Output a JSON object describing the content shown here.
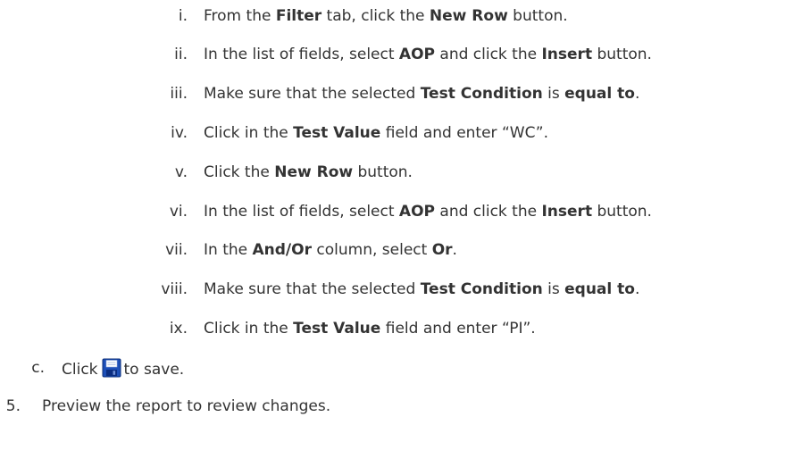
{
  "substeps": [
    {
      "numeral": "i.",
      "segments": [
        {
          "text": "From the ",
          "bold": false
        },
        {
          "text": "Filter",
          "bold": true
        },
        {
          "text": " tab, click the ",
          "bold": false
        },
        {
          "text": "New Row",
          "bold": true
        },
        {
          "text": " button.",
          "bold": false
        }
      ]
    },
    {
      "numeral": "ii.",
      "segments": [
        {
          "text": "In the list of fields, select ",
          "bold": false
        },
        {
          "text": "AOP",
          "bold": true
        },
        {
          "text": " and click the ",
          "bold": false
        },
        {
          "text": "Insert",
          "bold": true
        },
        {
          "text": " button.",
          "bold": false
        }
      ]
    },
    {
      "numeral": "iii.",
      "segments": [
        {
          "text": "Make sure that the selected ",
          "bold": false
        },
        {
          "text": "Test Condition",
          "bold": true
        },
        {
          "text": " is ",
          "bold": false
        },
        {
          "text": "equal to",
          "bold": true
        },
        {
          "text": ".",
          "bold": false
        }
      ]
    },
    {
      "numeral": "iv.",
      "segments": [
        {
          "text": "Click in the ",
          "bold": false
        },
        {
          "text": "Test Value",
          "bold": true
        },
        {
          "text": " field and enter “WC”.",
          "bold": false
        }
      ]
    },
    {
      "numeral": "v.",
      "segments": [
        {
          "text": "Click the ",
          "bold": false
        },
        {
          "text": "New Row",
          "bold": true
        },
        {
          "text": " button.",
          "bold": false
        }
      ]
    },
    {
      "numeral": "vi.",
      "segments": [
        {
          "text": "In the list of fields, select ",
          "bold": false
        },
        {
          "text": "AOP",
          "bold": true
        },
        {
          "text": " and click the ",
          "bold": false
        },
        {
          "text": "Insert",
          "bold": true
        },
        {
          "text": " button.",
          "bold": false
        }
      ]
    },
    {
      "numeral": "vii.",
      "segments": [
        {
          "text": "In the ",
          "bold": false
        },
        {
          "text": "And/Or",
          "bold": true
        },
        {
          "text": " column, select ",
          "bold": false
        },
        {
          "text": "Or",
          "bold": true
        },
        {
          "text": ".",
          "bold": false
        }
      ]
    },
    {
      "numeral": "viii.",
      "segments": [
        {
          "text": "Make sure that the selected ",
          "bold": false
        },
        {
          "text": "Test Condition",
          "bold": true
        },
        {
          "text": " is ",
          "bold": false
        },
        {
          "text": "equal to",
          "bold": true
        },
        {
          "text": ".",
          "bold": false
        }
      ]
    },
    {
      "numeral": "ix.",
      "segments": [
        {
          "text": "Click in the ",
          "bold": false
        },
        {
          "text": "Test Value",
          "bold": true
        },
        {
          "text": " field and enter “PI”.",
          "bold": false
        }
      ]
    }
  ],
  "step_c": {
    "letter": "c.",
    "before_icon": "Click",
    "icon": "save-icon",
    "after_icon": "to save."
  },
  "step_5": {
    "number": "5.",
    "text": "Preview the report to review changes."
  }
}
